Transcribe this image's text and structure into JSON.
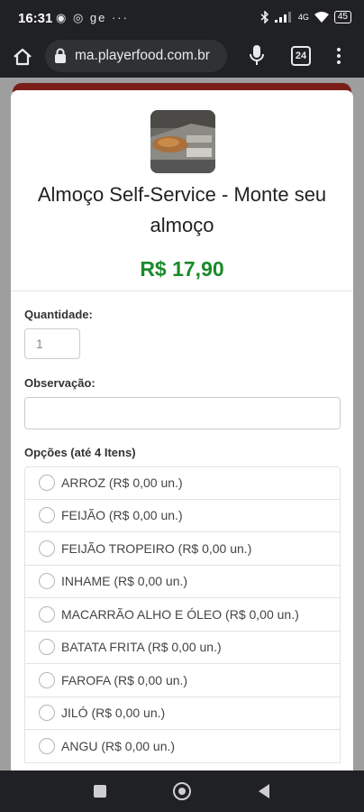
{
  "status_bar": {
    "time": "16:31",
    "notifications": "◉ ◎ ge ···",
    "signal": "4G",
    "battery": "45"
  },
  "browser": {
    "url": "ma.playerfood.com.br",
    "tab_count": "24",
    "icons": [
      "home-icon",
      "lock-icon",
      "mic-icon",
      "tabs-icon",
      "menu-icon"
    ]
  },
  "product": {
    "title": "Almoço Self-Service - Monte seu almoço",
    "price": "R$ 17,90",
    "price_color": "#1a8a2a"
  },
  "form": {
    "quantity_label": "Quantidade:",
    "quantity_value": "1",
    "observation_label": "Observação:",
    "observation_value": "",
    "options_label": "Opções (até 4 Itens)",
    "options": [
      {
        "label": "ARROZ (R$ 0,00 un.)"
      },
      {
        "label": "FEIJÃO (R$ 0,00 un.)"
      },
      {
        "label": "FEIJÃO TROPEIRO (R$ 0,00 un.)"
      },
      {
        "label": "INHAME (R$ 0,00 un.)"
      },
      {
        "label": "MACARRÃO ALHO E ÓLEO (R$ 0,00 un.)"
      },
      {
        "label": "BATATA FRITA (R$ 0,00 un.)"
      },
      {
        "label": "FAROFA (R$ 0,00 un.)"
      },
      {
        "label": "JILÓ (R$ 0,00 un.)"
      },
      {
        "label": "ANGU (R$ 0,00 un.)"
      }
    ]
  },
  "colors": {
    "header_strip": "#7a1e1a",
    "chrome_dark": "#202124"
  }
}
